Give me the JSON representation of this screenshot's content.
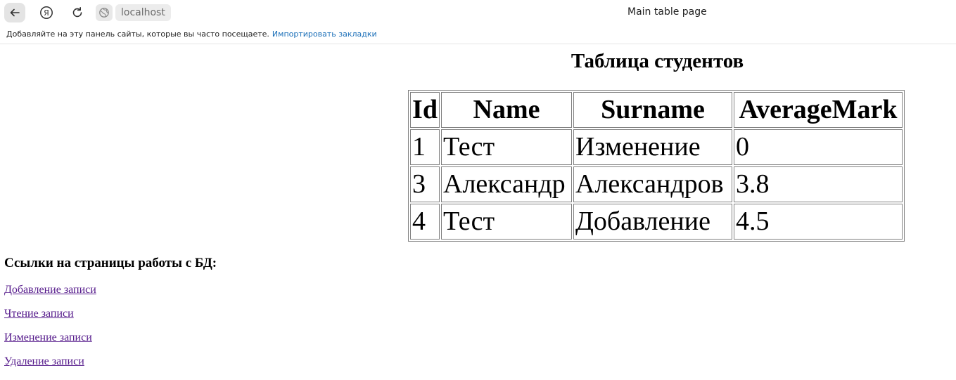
{
  "browser": {
    "url": "localhost",
    "tab_title": "Main table page",
    "bookmarks_bar_text": "Добавляйте на эту панель сайты, которые вы часто посещаете.",
    "bookmarks_import_link": "Импортировать закладки",
    "yandex_glyph": "Я"
  },
  "page": {
    "title": "Таблица студентов",
    "table": {
      "headers": [
        "Id",
        "Name",
        "Surname",
        "AverageMark"
      ],
      "rows": [
        [
          "1",
          "Тест",
          "Изменение",
          "0"
        ],
        [
          "3",
          "Александр",
          "Александров",
          "3.8"
        ],
        [
          "4",
          "Тест",
          "Добавление",
          "4.5"
        ]
      ]
    },
    "links_heading": "Ссылки на страницы работы с БД:",
    "links": [
      "Добавление записи",
      "Чтение записи",
      "Изменение записи",
      "Удаление записи"
    ]
  },
  "colors": {
    "visited_link": "#551a8b",
    "bookmark_link": "#1b6fb8",
    "table_border": "#808080"
  }
}
